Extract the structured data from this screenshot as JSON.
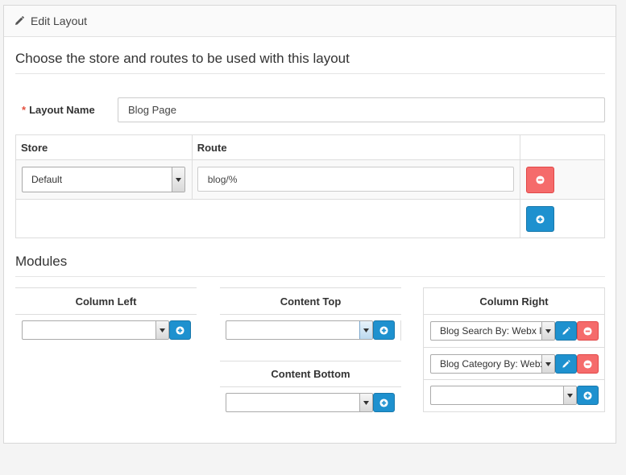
{
  "panel": {
    "title": "Edit Layout"
  },
  "section_routes": {
    "title": "Choose the store and routes to be used with this layout"
  },
  "layout_name": {
    "label": "Layout Name",
    "required_mark": "*",
    "value": "Blog Page"
  },
  "routes_table": {
    "headers": {
      "store": "Store",
      "route": "Route"
    },
    "rows": [
      {
        "store": "Default",
        "route": "blog/%"
      }
    ]
  },
  "section_modules": {
    "title": "Modules"
  },
  "modules": {
    "column_left": {
      "title": "Column Left",
      "select_value": ""
    },
    "content_top": {
      "title": "Content Top",
      "select_value": ""
    },
    "content_bottom": {
      "title": "Content Bottom",
      "select_value": ""
    },
    "column_right": {
      "title": "Column Right",
      "items": [
        "Blog Search By: Webx IT",
        "Blog Category By: Webx IT"
      ],
      "select_value": ""
    }
  },
  "colors": {
    "primary": "#1e91cf",
    "danger": "#f56b6b",
    "required": "#e3503e"
  },
  "icons": {
    "heading": "pencil-icon",
    "remove": "minus-circle-icon",
    "add": "plus-circle-icon",
    "edit": "pencil-icon"
  }
}
